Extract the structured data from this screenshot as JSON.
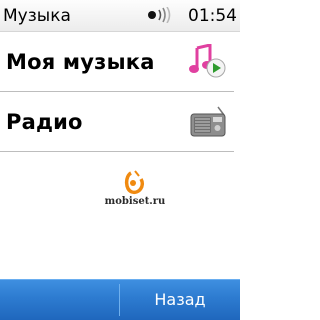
{
  "status_bar": {
    "title": "Музыка",
    "time": "01:54",
    "signal_icon": "signal-waves-icon"
  },
  "menu": {
    "items": [
      {
        "label": "Моя музыка",
        "icon": "music-library-icon"
      },
      {
        "label": "Радио",
        "icon": "radio-icon"
      }
    ]
  },
  "watermark": {
    "text": "mobiset.ru",
    "logo_icon": "mobiset-logo-icon"
  },
  "softkeys": {
    "back_label": "Назад"
  },
  "colors": {
    "softkey_bar": "#2d7bd0",
    "music_icon": "#e040a0",
    "play_icon": "#2e9b2e",
    "logo": "#f08a10"
  }
}
